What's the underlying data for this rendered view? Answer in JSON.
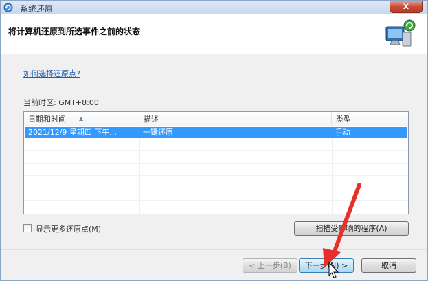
{
  "window": {
    "title": "系统还原",
    "close_label": "x",
    "icon": "system-restore-icon"
  },
  "header": {
    "title": "将计算机还原到所选事件之前的状态",
    "icon": "computer-restore-icon"
  },
  "help_link": "如何选择还原点?",
  "timezone": {
    "text": "当前时区: GMT+8:00"
  },
  "table": {
    "columns": [
      "日期和时间",
      "描述",
      "类型"
    ],
    "rows": [
      {
        "datetime": "2021/12/9 星期四 下午...",
        "description": "一键还原",
        "type": "手动",
        "selected": true
      }
    ]
  },
  "show_more": {
    "label": "显示更多还原点(M)",
    "checked": false
  },
  "buttons": {
    "scan": "扫描受影响的程序(A)",
    "back": "< 上一步(B)",
    "next": "下一步(N) >",
    "cancel": "取消"
  },
  "annotation": {
    "color": "#e8302a"
  }
}
